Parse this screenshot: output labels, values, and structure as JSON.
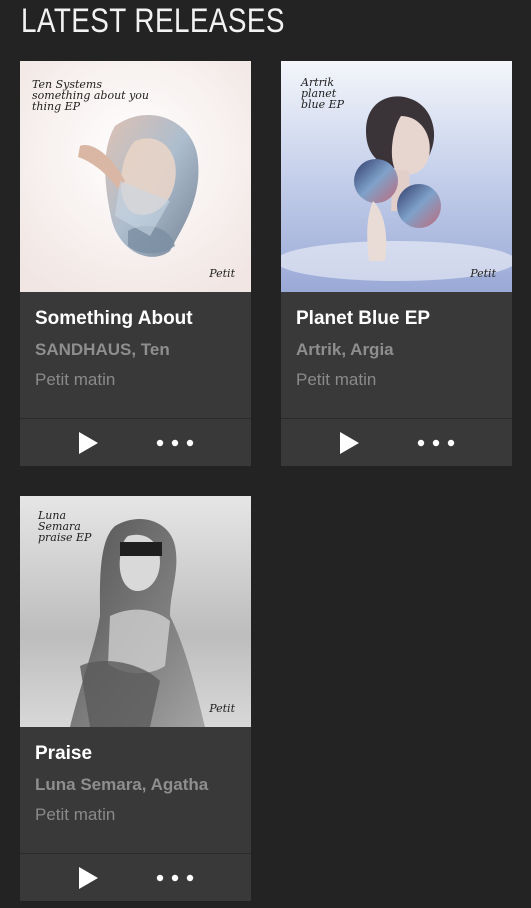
{
  "section": {
    "title": "LATEST RELEASES"
  },
  "releases": [
    {
      "title": "Something About",
      "artists": "SANDHAUS, Ten",
      "label": "Petit matin",
      "cover_text": "Ten Systems\nsomething about you\nthing EP",
      "cover_signature": "Petit"
    },
    {
      "title": "Planet Blue EP",
      "artists": "Artrik, Argia",
      "label": "Petit matin",
      "cover_text": "Artrik\nplanet\nblue EP",
      "cover_signature": "Petit"
    },
    {
      "title": "Praise",
      "artists": "Luna Semara, Agatha",
      "label": "Petit matin",
      "cover_text": "Luna\nSemara\npraise EP",
      "cover_signature": "Petit"
    }
  ],
  "icons": {
    "play": "play-icon",
    "more": "more-options-icon"
  },
  "colors": {
    "background": "#232323",
    "card": "#393939",
    "title": "#ffffff",
    "muted": "#8e8e8e"
  }
}
